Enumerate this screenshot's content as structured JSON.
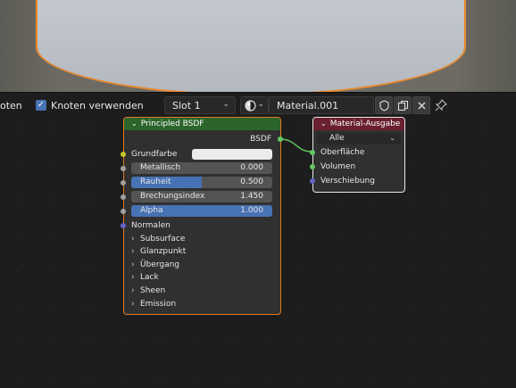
{
  "header": {
    "partial_label": "oten",
    "use_nodes_label": "Knoten verwenden",
    "use_nodes_checked": true,
    "slot_value": "Slot 1",
    "material_name": "Material.001"
  },
  "icons": {
    "checkbox": "check-icon",
    "slot_dropdown": "chevron-down-icon",
    "material_browse": "sphere-icon",
    "fake_user": "shield-icon",
    "duplicate": "duplicate-icon",
    "unlink": "close-icon",
    "pin": "pin-icon"
  },
  "colors": {
    "bsdf_header": "#2b652b",
    "output_header": "#6a2030",
    "accent": "#4772b3",
    "selection": "#e07a1f"
  },
  "bsdf_node": {
    "title": "Principled BSDF",
    "output_label": "BSDF",
    "base_color_label": "Grundfarbe",
    "metallic": {
      "label": "Metallisch",
      "value": "0.000",
      "fraction": 0.0
    },
    "roughness": {
      "label": "Rauheit",
      "value": "0.500",
      "fraction": 0.5
    },
    "ior": {
      "label": "Brechungsindex",
      "value": "1.450",
      "fraction": 0.0
    },
    "alpha": {
      "label": "Alpha",
      "value": "1.000",
      "fraction": 1.0
    },
    "normal_label": "Normalen",
    "panels": [
      "Subsurface",
      "Glanzpunkt",
      "Übergang",
      "Lack",
      "Sheen",
      "Emission"
    ]
  },
  "output_node": {
    "title": "Material-Ausgabe",
    "target": "Alle",
    "inputs": [
      "Oberfläche",
      "Volumen",
      "Verschiebung"
    ]
  }
}
